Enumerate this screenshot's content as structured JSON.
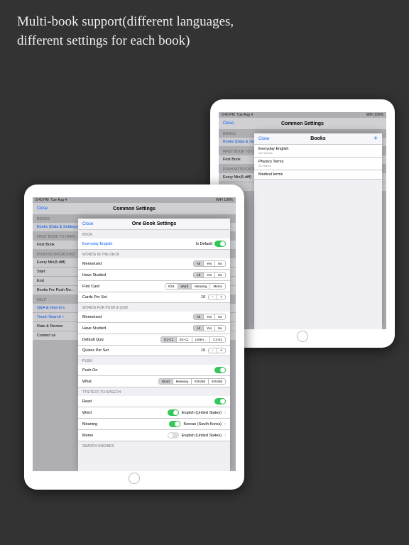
{
  "caption_line1": "Multi-book support(different languages,",
  "caption_line2": "different settings for each book)",
  "status": {
    "time": "8:40 PM",
    "date": "Tue Aug 4",
    "wifi": "WiFi",
    "battery": "100%"
  },
  "common": {
    "close": "Close",
    "title": "Common Settings",
    "hdr_books": "BOOKS",
    "books_link": "Books (Data & Settings)",
    "hdr_first": "FIRST BOOK TO OPEN",
    "first_book": "First Book",
    "hdr_push": "PUSH NOTIFICATIONS",
    "every_min": "Every Min(5.diff)",
    "start": "Start",
    "end": "End",
    "books_for_push": "Books For Push No…",
    "hdr_help": "HELP",
    "qna": "Q&A & How-to's",
    "touch_search": "Touch Search +",
    "rate": "Rate & Review",
    "contact": "Contact us"
  },
  "one": {
    "close": "Close",
    "title": "One Book Settings",
    "hdr_book": "BOOK",
    "book_name": "Everyday English",
    "is_default": "Is Default",
    "hdr_deck": "WORDS IN THE DECK",
    "memorized": "Memorized",
    "seg_mem": [
      "All",
      "Yes",
      "No"
    ],
    "have_studied": "Have Studied",
    "seg_studied": [
      "All",
      "Yes",
      "No"
    ],
    "first_card": "First Card",
    "seg_first": [
      "#/24",
      "Word",
      "Meaning",
      "Memo"
    ],
    "cards_per_set": "Cards Per Set",
    "cards_val": "10",
    "hdr_pq": "WORDS FOR PUSH & QUIZ",
    "memorized2": "Memorized",
    "seg_mem2": [
      "All",
      "Yes",
      "No"
    ],
    "have_studied2": "Have Studied",
    "seg_studied2": [
      "All",
      "Yes",
      "No"
    ],
    "default_quiz": "Default Quiz",
    "seg_quiz": [
      "E1-C1",
      "E2-C1",
      "Listen…",
      "C1-E1"
    ],
    "quizzes_per_set": "Quizes Per Set",
    "quizzes_val": "10",
    "hdr_push": "PUSH",
    "push_on": "Push On",
    "what": "What",
    "seg_what": [
      "Word",
      "Meaning",
      "#/24/56",
      "#/24/56"
    ],
    "hdr_tts": "TTS/TEXT-TO-SPEECH",
    "read": "Read",
    "word_lang": "Word",
    "word_lang_val": "English (United States)",
    "meaning_lang": "Meaning",
    "meaning_lang_val": "Korean (South Korea)",
    "memo_lang": "Memo",
    "memo_lang_val": "English (United States)",
    "hdr_search": "SEARCH ENGINES"
  },
  "books": {
    "close": "Close",
    "title": "Books",
    "add": "+",
    "items": [
      {
        "name": "Everyday English",
        "sub": "440 entries"
      },
      {
        "name": "Physics Terms",
        "sub": "20 entries"
      },
      {
        "name": "Medical terms",
        "sub": ""
      }
    ]
  }
}
